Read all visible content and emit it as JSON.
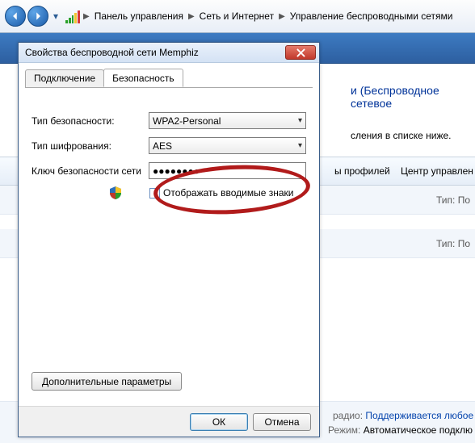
{
  "breadcrumbs": {
    "a": "Панель управления",
    "b": "Сеть и Интернет",
    "c": "Управление беспроводными сетями"
  },
  "bg": {
    "title_partial": "и (Беспроводное сетевое",
    "list_hint_partial": "сления в списке ниже.",
    "tool_profiles": "ы профилей",
    "tool_center": "Центр управлен",
    "meta_type_lbl": "Тип:",
    "meta_type_val": "По",
    "footer_radio_lbl": "радио:",
    "footer_radio_val": "Поддерживается любое",
    "footer_mode_lbl": "Режим:",
    "footer_mode_val": "Автоматическое подклю"
  },
  "dialog": {
    "title": "Свойства беспроводной сети Memphiz",
    "tabs": {
      "connect": "Подключение",
      "security": "Безопасность"
    },
    "security_type_lbl": "Тип безопасности:",
    "security_type_val": "WPA2-Personal",
    "encryption_lbl": "Тип шифрования:",
    "encryption_val": "AES",
    "key_lbl": "Ключ безопасности сети",
    "key_val": "●●●●●●●●",
    "show_chars": "Отображать вводимые знаки",
    "advanced": "Дополнительные параметры",
    "ok": "ОК",
    "cancel": "Отмена"
  }
}
